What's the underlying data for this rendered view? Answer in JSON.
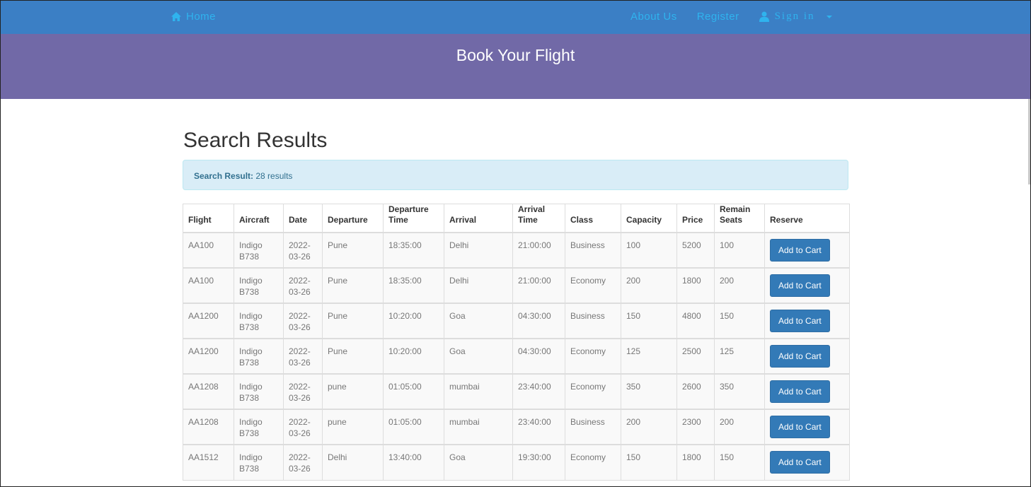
{
  "nav": {
    "home": "Home",
    "about": "About Us",
    "register": "Register",
    "signin": "Sign in"
  },
  "hero": {
    "title": "Book Your Flight"
  },
  "results": {
    "heading": "Search Results",
    "alert_label": "Search Result:",
    "alert_text": "28 results"
  },
  "table": {
    "headers": [
      "Flight",
      "Aircraft",
      "Date",
      "Departure",
      "Departure Time",
      "Arrival",
      "Arrival Time",
      "Class",
      "Capacity",
      "Price",
      "Remain Seats",
      "Reserve"
    ],
    "button_label": "Add to Cart",
    "rows": [
      {
        "flight": "AA100",
        "aircraft": "Indigo B738",
        "date": "2022-03-26",
        "departure": "Pune",
        "dep_time": "18:35:00",
        "arrival": "Delhi",
        "arr_time": "21:00:00",
        "class": "Business",
        "capacity": "100",
        "price": "5200",
        "remain": "100"
      },
      {
        "flight": "AA100",
        "aircraft": "Indigo B738",
        "date": "2022-03-26",
        "departure": "Pune",
        "dep_time": "18:35:00",
        "arrival": "Delhi",
        "arr_time": "21:00:00",
        "class": "Economy",
        "capacity": "200",
        "price": "1800",
        "remain": "200"
      },
      {
        "flight": "AA1200",
        "aircraft": "Indigo B738",
        "date": "2022-03-26",
        "departure": "Pune",
        "dep_time": "10:20:00",
        "arrival": "Goa",
        "arr_time": "04:30:00",
        "class": "Business",
        "capacity": "150",
        "price": "4800",
        "remain": "150"
      },
      {
        "flight": "AA1200",
        "aircraft": "Indigo B738",
        "date": "2022-03-26",
        "departure": "Pune",
        "dep_time": "10:20:00",
        "arrival": "Goa",
        "arr_time": "04:30:00",
        "class": "Economy",
        "capacity": "125",
        "price": "2500",
        "remain": "125"
      },
      {
        "flight": "AA1208",
        "aircraft": "Indigo B738",
        "date": "2022-03-26",
        "departure": "pune",
        "dep_time": "01:05:00",
        "arrival": "mumbai",
        "arr_time": "23:40:00",
        "class": "Economy",
        "capacity": "350",
        "price": "2600",
        "remain": "350"
      },
      {
        "flight": "AA1208",
        "aircraft": "Indigo B738",
        "date": "2022-03-26",
        "departure": "pune",
        "dep_time": "01:05:00",
        "arrival": "mumbai",
        "arr_time": "23:40:00",
        "class": "Business",
        "capacity": "200",
        "price": "2300",
        "remain": "200"
      },
      {
        "flight": "AA1512",
        "aircraft": "Indigo B738",
        "date": "2022-03-26",
        "departure": "Delhi",
        "dep_time": "13:40:00",
        "arrival": "Goa",
        "arr_time": "19:30:00",
        "class": "Economy",
        "capacity": "150",
        "price": "1800",
        "remain": "150"
      }
    ]
  },
  "colors": {
    "navbar": "#3b7fc5",
    "nav_text": "#2fb3ee",
    "hero": "#7169a7",
    "alert_bg": "#d9edf7",
    "button": "#337ab7"
  }
}
